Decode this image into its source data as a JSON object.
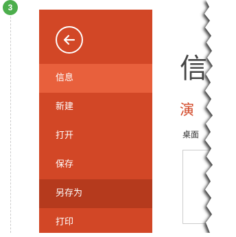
{
  "step": {
    "number": "3"
  },
  "backstage": {
    "back_icon": "arrow-left-icon",
    "accent_color": "#d24726",
    "menu": [
      {
        "label": "信息",
        "state": "selected"
      },
      {
        "label": "新建",
        "state": "normal"
      },
      {
        "label": "打开",
        "state": "normal"
      },
      {
        "label": "保存",
        "state": "normal"
      },
      {
        "label": "另存为",
        "state": "hovered"
      },
      {
        "label": "打印",
        "state": "normal"
      }
    ]
  },
  "content": {
    "title": "信",
    "document_name": "演",
    "location": "桌面"
  }
}
